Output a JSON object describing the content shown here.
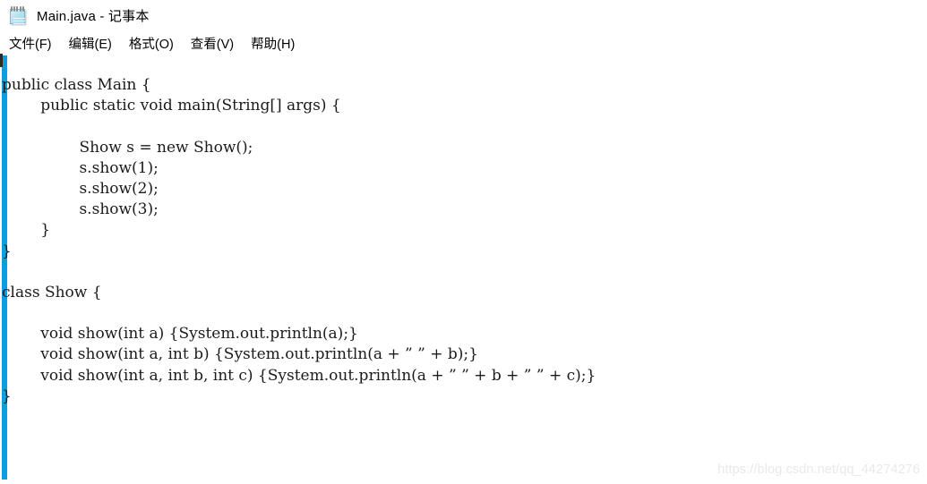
{
  "window": {
    "title": "Main.java - 记事本",
    "icon": "notepad-icon"
  },
  "menubar": {
    "items": [
      {
        "label": "文件(F)"
      },
      {
        "label": "编辑(E)"
      },
      {
        "label": "格式(O)"
      },
      {
        "label": "查看(V)"
      },
      {
        "label": "帮助(H)"
      }
    ]
  },
  "editor": {
    "accent_color": "#0f9ddb",
    "text_color": "#1b1b1b",
    "background_color": "#ffffff",
    "lines": [
      "public class Main {",
      "        public static void main(String[] args) {",
      "",
      "                Show s = new Show();",
      "                s.show(1);",
      "                s.show(2);",
      "                s.show(3);",
      "        }",
      "}",
      "",
      "class Show {",
      "",
      "        void show(int a) {System.out.println(a);}",
      "        void show(int a, int b) {System.out.println(a + ” ” + b);}",
      "        void show(int a, int b, int c) {System.out.println(a + ” ” + b + ” ” + c);}",
      "}"
    ]
  },
  "watermark": {
    "text": "https://blog.csdn.net/qq_44274276",
    "color": "#e9e9e9"
  }
}
